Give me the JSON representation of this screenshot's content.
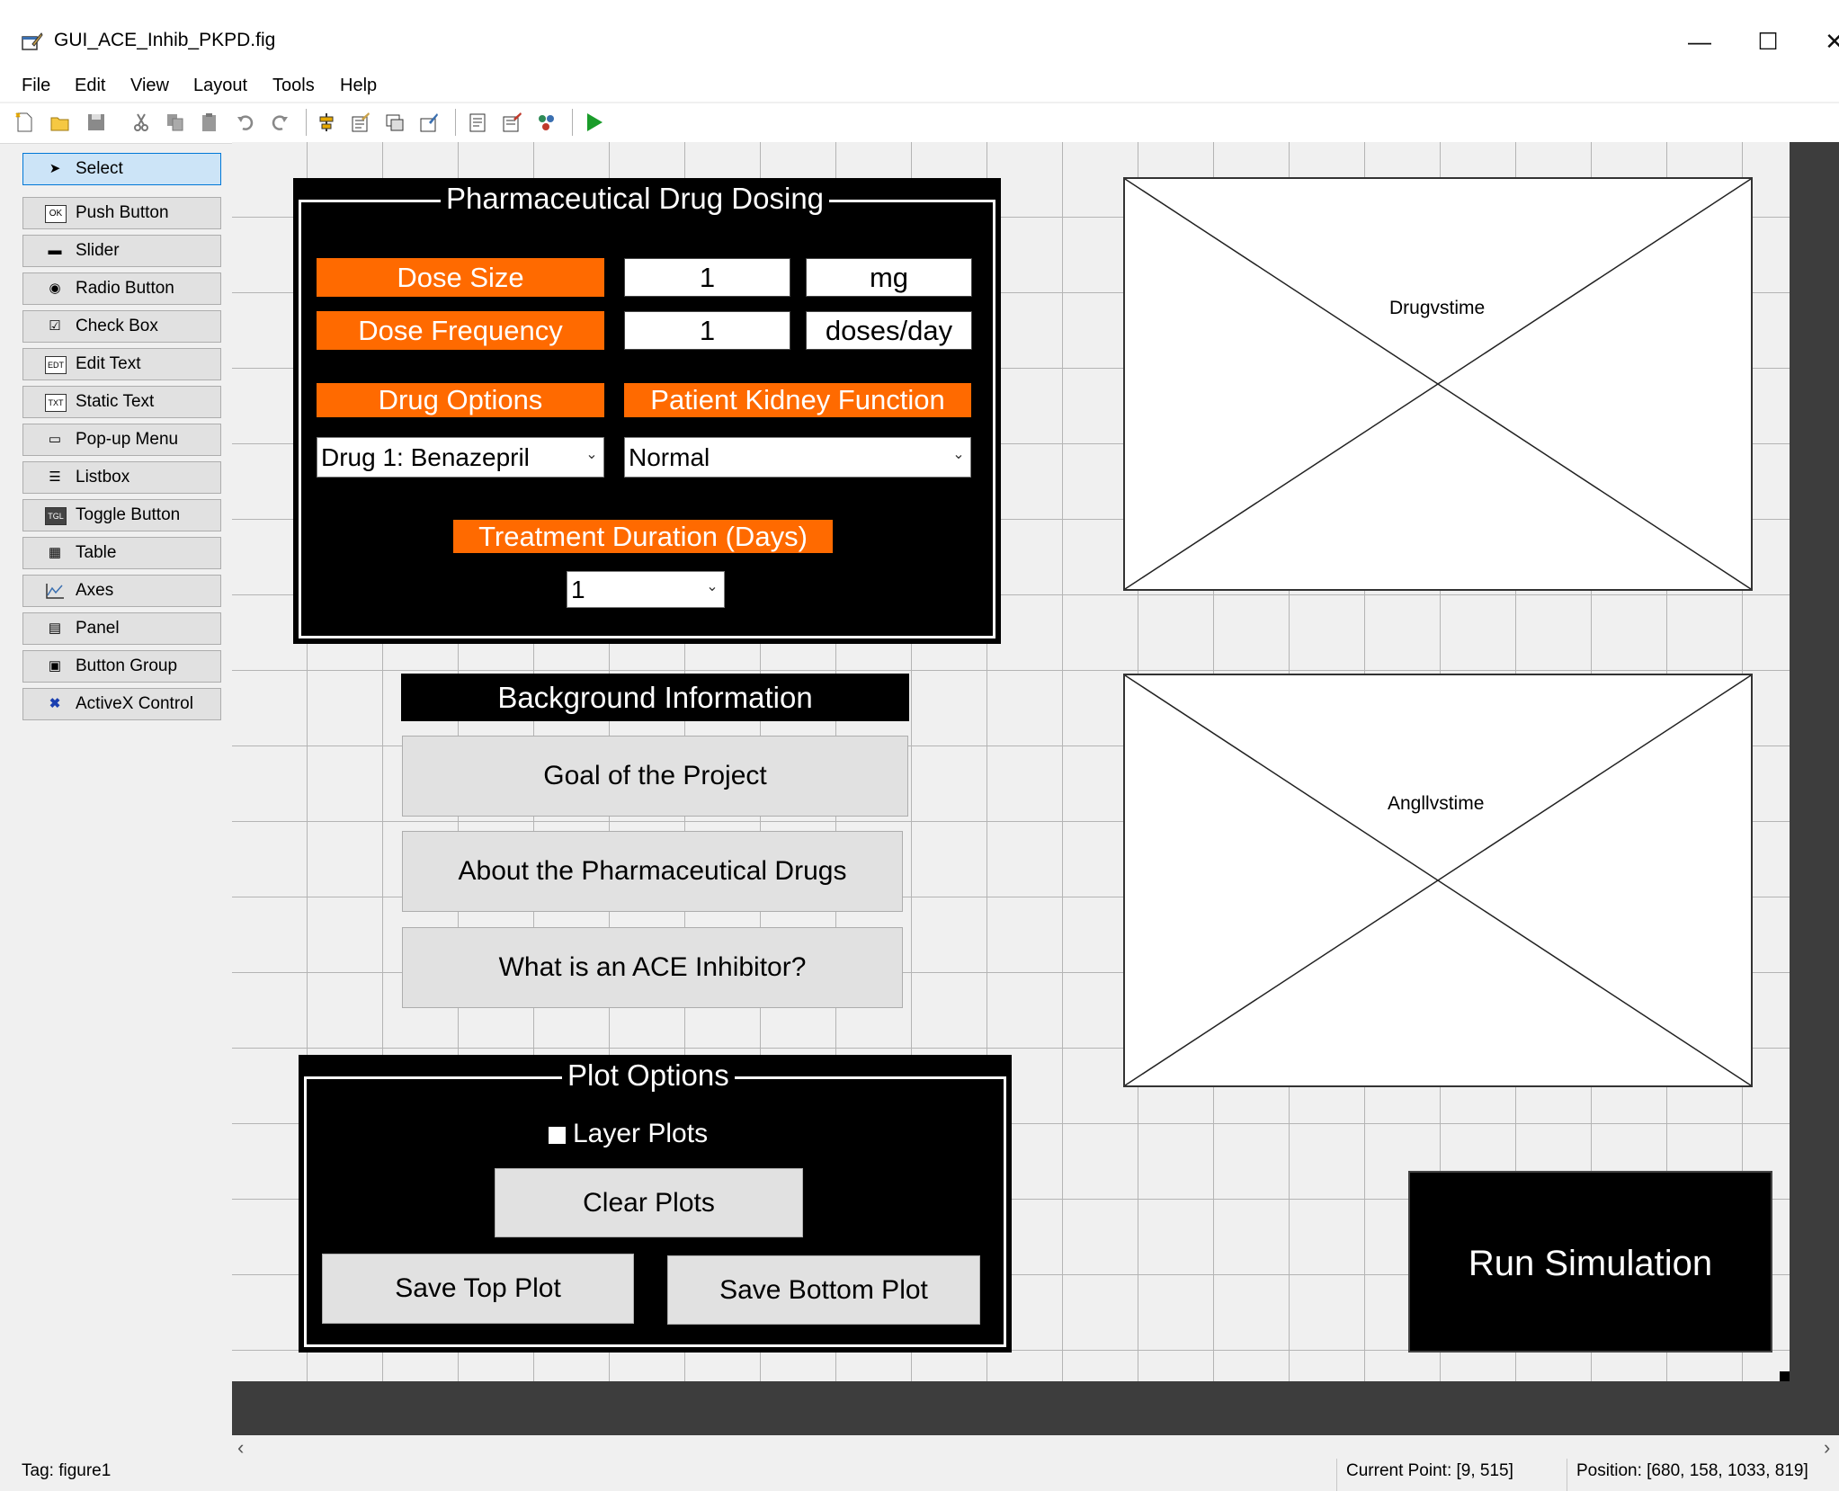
{
  "window": {
    "title": "GUI_ACE_Inhib_PKPD.fig",
    "minimize_glyph": "—",
    "maximize_glyph": "☐",
    "close_glyph": "✕"
  },
  "menu": [
    "File",
    "Edit",
    "View",
    "Layout",
    "Tools",
    "Help"
  ],
  "palette": {
    "items": [
      {
        "label": "Select",
        "icon": "arrow-pointer-icon"
      },
      {
        "label": "Push Button",
        "icon": "push-button-icon"
      },
      {
        "label": "Slider",
        "icon": "slider-icon"
      },
      {
        "label": "Radio Button",
        "icon": "radio-button-icon"
      },
      {
        "label": "Check Box",
        "icon": "check-box-icon"
      },
      {
        "label": "Edit Text",
        "icon": "edit-text-icon"
      },
      {
        "label": "Static Text",
        "icon": "static-text-icon"
      },
      {
        "label": "Pop-up Menu",
        "icon": "popup-menu-icon"
      },
      {
        "label": "Listbox",
        "icon": "listbox-icon"
      },
      {
        "label": "Toggle Button",
        "icon": "toggle-button-icon"
      },
      {
        "label": "Table",
        "icon": "table-icon"
      },
      {
        "label": "Axes",
        "icon": "axes-icon"
      },
      {
        "label": "Panel",
        "icon": "panel-icon"
      },
      {
        "label": "Button Group",
        "icon": "button-group-icon"
      },
      {
        "label": "ActiveX Control",
        "icon": "activex-icon"
      }
    ],
    "icon_glyphs": [
      "➤",
      "OK",
      "▬",
      "◉",
      "☑",
      "EDT",
      "TXT",
      "▭",
      "☰",
      "TGL",
      "▦",
      "📈",
      "▤",
      "▣",
      "✖"
    ]
  },
  "dosing_panel": {
    "title": "Pharmaceutical Drug Dosing",
    "dose_size_label": "Dose Size",
    "dose_size_value": "1",
    "dose_size_unit": "mg",
    "dose_freq_label": "Dose Frequency",
    "dose_freq_value": "1",
    "dose_freq_unit": "doses/day",
    "drug_options_label": "Drug Options",
    "drug_options_value": "Drug 1: Benazepril",
    "kidney_label": "Patient Kidney Function",
    "kidney_value": "Normal",
    "duration_label": "Treatment Duration (Days)",
    "duration_value": "1",
    "dropdown_glyph": "⌄"
  },
  "background": {
    "header": "Background Information",
    "goal_button": "Goal of the Project",
    "about_button": "About the Pharmaceutical Drugs",
    "ace_button": "What is an ACE Inhibitor?"
  },
  "plot_options": {
    "title": "Plot Options",
    "layer_checkbox_label": "Layer Plots",
    "layer_checked": false,
    "clear_button": "Clear Plots",
    "save_top_button": "Save Top Plot",
    "save_bottom_button": "Save Bottom Plot"
  },
  "axes": {
    "top_tag": "Drugvstime",
    "bottom_tag": "Angllvstime"
  },
  "run_button": "Run Simulation",
  "status": {
    "tag": "Tag: figure1",
    "current_point": "Current Point:  [9, 515]",
    "position": "Position: [680, 158, 1033, 819]"
  },
  "colors": {
    "orange": "#ff6a00",
    "panel_black": "#000000",
    "canvas_bg": "#f0f0f0",
    "grid": "#b4b4b4",
    "select_highlight": "#cce4f7"
  }
}
